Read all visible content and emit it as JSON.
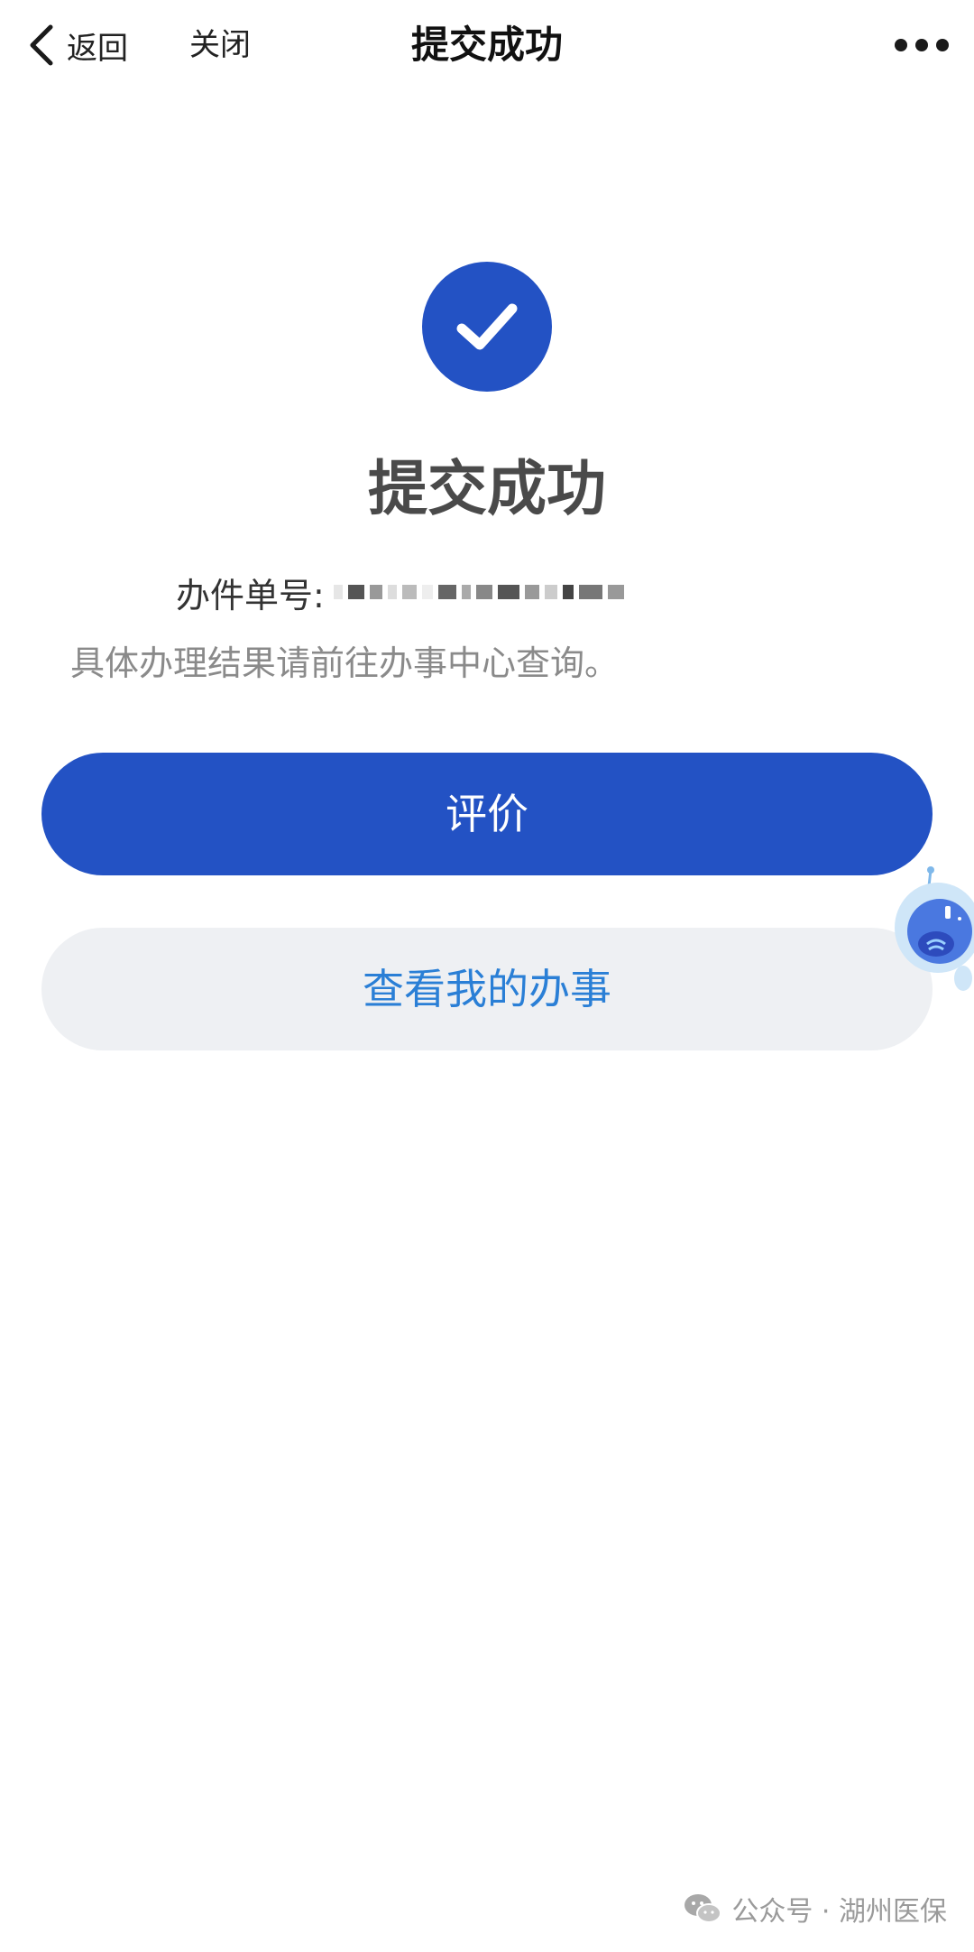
{
  "navbar": {
    "back_label": "返回",
    "close_label": "关闭",
    "title": "提交成功"
  },
  "result": {
    "title": "提交成功",
    "order_label": "办件单号:",
    "hint": "具体办理结果请前往办事中心查询。"
  },
  "buttons": {
    "evaluate_label": "评价",
    "view_my_affairs_label": "查看我的办事"
  },
  "watermark": {
    "text": "公众号 · 湖州医保"
  },
  "colors": {
    "primary": "#2352c4",
    "secondary_bg": "#eef0f3",
    "secondary_text": "#2a7fd6",
    "hint_text": "#8a8a8a"
  }
}
